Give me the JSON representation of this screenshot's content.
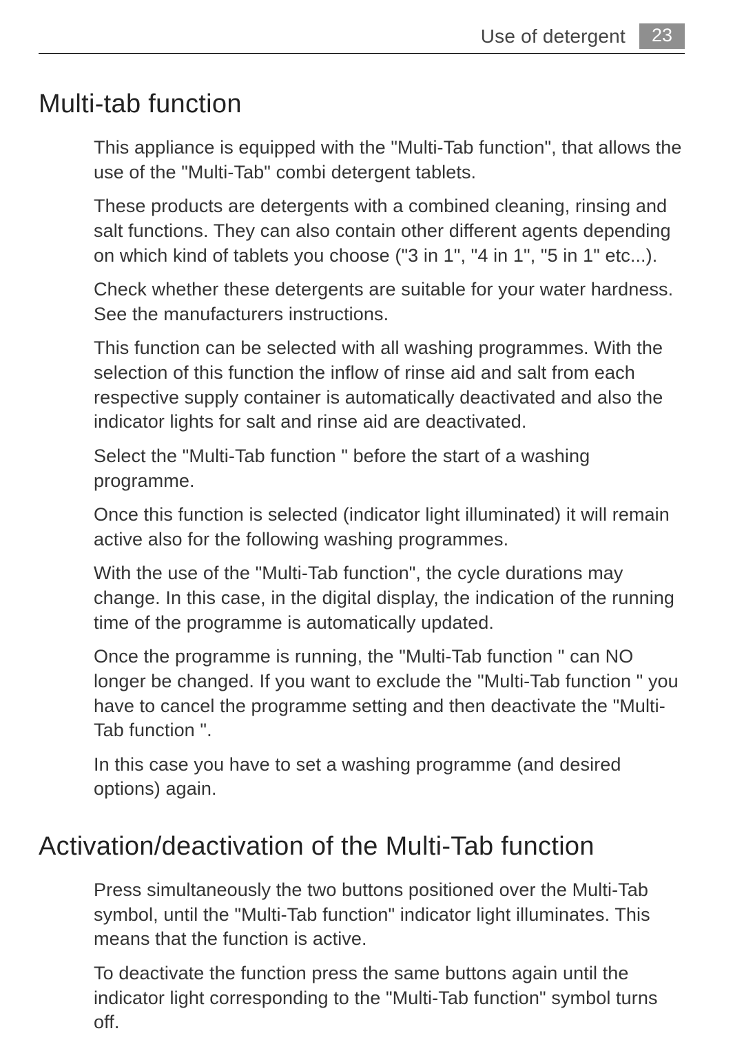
{
  "header": {
    "section": "Use of detergent",
    "page_number": "23"
  },
  "section1": {
    "heading": "Multi-tab function",
    "paragraphs": [
      "This appliance is equipped with the \"Multi-Tab function\", that allows the use of the \"Multi-Tab\" combi detergent tablets.",
      "These products are detergents with a combined cleaning, rinsing and salt functions. They can also contain other different agents depending on which kind of tablets you choose (\"3 in 1\", \"4 in 1\", \"5 in 1\" etc...).",
      "Check whether these detergents are suitable for your water hardness. See the manufacturers instructions.",
      "This function can be selected with all washing programmes. With the selection of this function the inflow of rinse aid and salt from each respective supply container is automatically deactivated and also the indicator lights for salt and rinse aid are deactivated.",
      "Select the \"Multi-Tab function \" before the start of a washing programme.",
      "Once this function is selected (indicator light illuminated) it will remain active also for the following washing programmes.",
      "With the use of the \"Multi-Tab function\", the cycle durations may change. In this case, in the digital display, the indication of the running time of the programme is automatically updated.",
      "Once the programme is running, the \"Multi-Tab function \" can NO longer be changed. If you want to exclude the \"Multi-Tab function \" you have to cancel the programme setting and then deactivate the \"Multi-Tab function \".",
      "In this case you have to set a washing programme (and desired options) again."
    ]
  },
  "section2": {
    "heading": "Activation/deactivation of the Multi-Tab function",
    "paragraphs": [
      "Press simultaneously the two buttons positioned over the Multi-Tab symbol, until the \"Multi-Tab function\" indicator light illuminates. This means that the function is active.",
      "To deactivate the function press the same buttons again until the indicator light corresponding to the \"Multi-Tab function\" symbol turns off."
    ]
  }
}
